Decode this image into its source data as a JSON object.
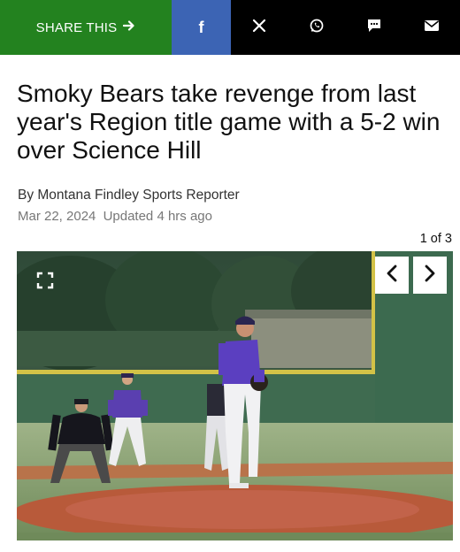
{
  "share": {
    "label": "SHARE THIS",
    "facebook": "f",
    "x": "𝕏",
    "colors": {
      "green": "#23821f",
      "facebook": "#3c64b4",
      "black": "#000000"
    }
  },
  "article": {
    "headline": "Smoky Bears take revenge from last year's Region title game with a 5-2 win over Science Hill",
    "byline": "By Montana Findley Sports Reporter",
    "date": "Mar 22, 2024",
    "updated": "Updated 4 hrs ago"
  },
  "gallery": {
    "counter": "1 of 3",
    "prev_icon": "chevron-left-icon",
    "next_icon": "chevron-right-icon",
    "expand_icon": "fullscreen-icon"
  }
}
